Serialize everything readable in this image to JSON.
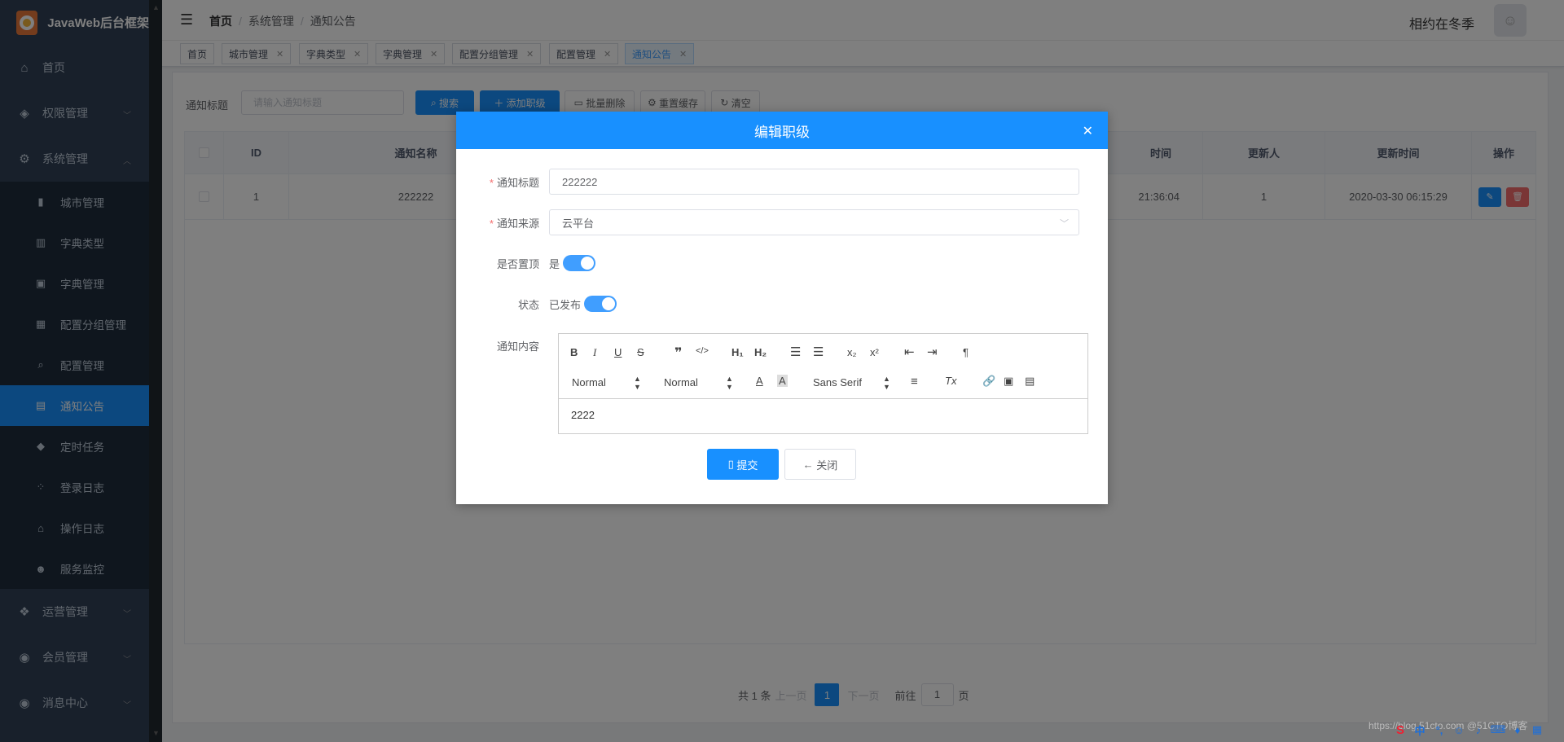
{
  "app": {
    "title": "JavaWeb后台框架"
  },
  "sidebar": {
    "items": [
      {
        "label": "首页",
        "icon": "home-icon",
        "level": 1
      },
      {
        "label": "权限管理",
        "icon": "shield-icon",
        "level": 1,
        "expandable": true
      },
      {
        "label": "系统管理",
        "icon": "gear-icon",
        "level": 1,
        "expandable": true,
        "expanded": true
      },
      {
        "label": "城市管理",
        "icon": "chart-icon",
        "level": 2
      },
      {
        "label": "字典类型",
        "icon": "book-icon",
        "level": 2
      },
      {
        "label": "字典管理",
        "icon": "dict-icon",
        "level": 2
      },
      {
        "label": "配置分组管理",
        "icon": "grid-icon",
        "level": 2
      },
      {
        "label": "配置管理",
        "icon": "search-doc-icon",
        "level": 2
      },
      {
        "label": "通知公告",
        "icon": "notice-icon",
        "level": 2,
        "active": true
      },
      {
        "label": "定时任务",
        "icon": "timer-icon",
        "level": 2
      },
      {
        "label": "登录日志",
        "icon": "log-icon",
        "level": 2
      },
      {
        "label": "操作日志",
        "icon": "home-icon",
        "level": 2
      },
      {
        "label": "服务监控",
        "icon": "monitor-icon",
        "level": 2
      },
      {
        "label": "运营管理",
        "icon": "box-icon",
        "level": 1,
        "expandable": true
      },
      {
        "label": "会员管理",
        "icon": "member-icon",
        "level": 1,
        "expandable": true
      },
      {
        "label": "消息中心",
        "icon": "message-icon",
        "level": 1,
        "expandable": true
      }
    ]
  },
  "header": {
    "breadcrumb": [
      "首页",
      "系统管理",
      "通知公告"
    ],
    "username": "相约在冬季"
  },
  "tags": [
    {
      "label": "首页",
      "closable": false
    },
    {
      "label": "城市管理",
      "closable": true
    },
    {
      "label": "字典类型",
      "closable": true
    },
    {
      "label": "字典管理",
      "closable": true
    },
    {
      "label": "配置分组管理",
      "closable": true
    },
    {
      "label": "配置管理",
      "closable": true
    },
    {
      "label": "通知公告",
      "closable": true,
      "active": true
    }
  ],
  "search": {
    "label": "通知标题",
    "placeholder": "请输入通知标题",
    "buttons": {
      "search": "搜索",
      "add": "添加职级",
      "batch_delete": "批量删除",
      "reset_cache": "重置缓存",
      "clear": "清空"
    }
  },
  "table": {
    "headers": [
      "ID",
      "通知名称",
      "时间",
      "更新人",
      "更新时间",
      "操作"
    ],
    "rows": [
      {
        "id": "1",
        "name": "222222",
        "time": "21:36:04",
        "updater": "1",
        "updated": "2020-03-30 06:15:29"
      }
    ]
  },
  "pagination": {
    "total": "共 1 条",
    "prev": "上一页",
    "current": "1",
    "next": "下一页",
    "goto_label": "前往",
    "goto_value": "1",
    "page_unit": "页"
  },
  "dialog": {
    "title": "编辑职级",
    "fields": {
      "title_label": "通知标题",
      "title_value": "222222",
      "source_label": "通知来源",
      "source_value": "云平台",
      "top_label": "是否置顶",
      "top_value": "是",
      "status_label": "状态",
      "status_value": "已发布",
      "content_label": "通知内容",
      "content_value": "2222"
    },
    "toolbar": {
      "header_select": "Normal",
      "size_select": "Normal",
      "font_select": "Sans Serif"
    },
    "buttons": {
      "submit": "提交",
      "close": "关闭"
    }
  },
  "watermark": "https://blog.51cto.com @51CTO博客",
  "colors": {
    "primary": "#1890ff",
    "sidebar": "#304156",
    "danger": "#f56c6c"
  }
}
